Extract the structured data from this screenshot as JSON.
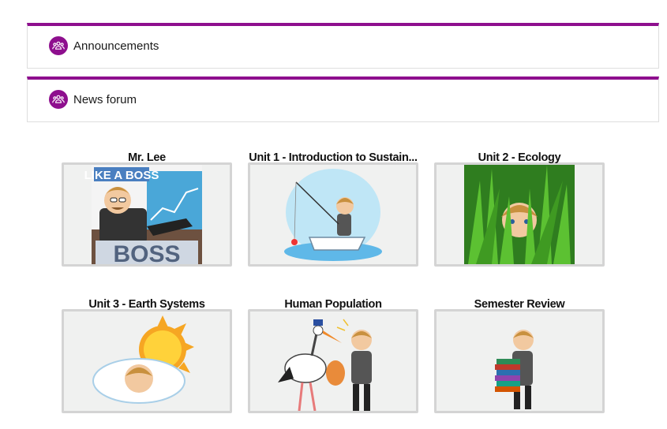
{
  "forums": [
    {
      "label": "Announcements",
      "icon": "forum-people-icon"
    },
    {
      "label": "News forum",
      "icon": "forum-people-icon"
    }
  ],
  "tiles": [
    {
      "title": "Mr. Lee",
      "image": "like-a-boss-avatar-illustration",
      "image_text": "LIKE A BOSS"
    },
    {
      "title": "Unit 1 - Introduction to Sustain...",
      "image": "fishing-boat-avatar-illustration"
    },
    {
      "title": "Unit 2 - Ecology",
      "image": "grass-hiding-avatar-illustration"
    },
    {
      "title": "Unit 3 - Earth Systems",
      "image": "sun-cloud-avatar-illustration"
    },
    {
      "title": "Human Population",
      "image": "stork-baby-avatar-illustration"
    },
    {
      "title": "Semester Review",
      "image": "stack-of-books-avatar-illustration"
    }
  ],
  "colors": {
    "accent": "#8e0f8e",
    "tile_border": "#d4d4d4",
    "tile_bg": "#f0f1f0"
  }
}
